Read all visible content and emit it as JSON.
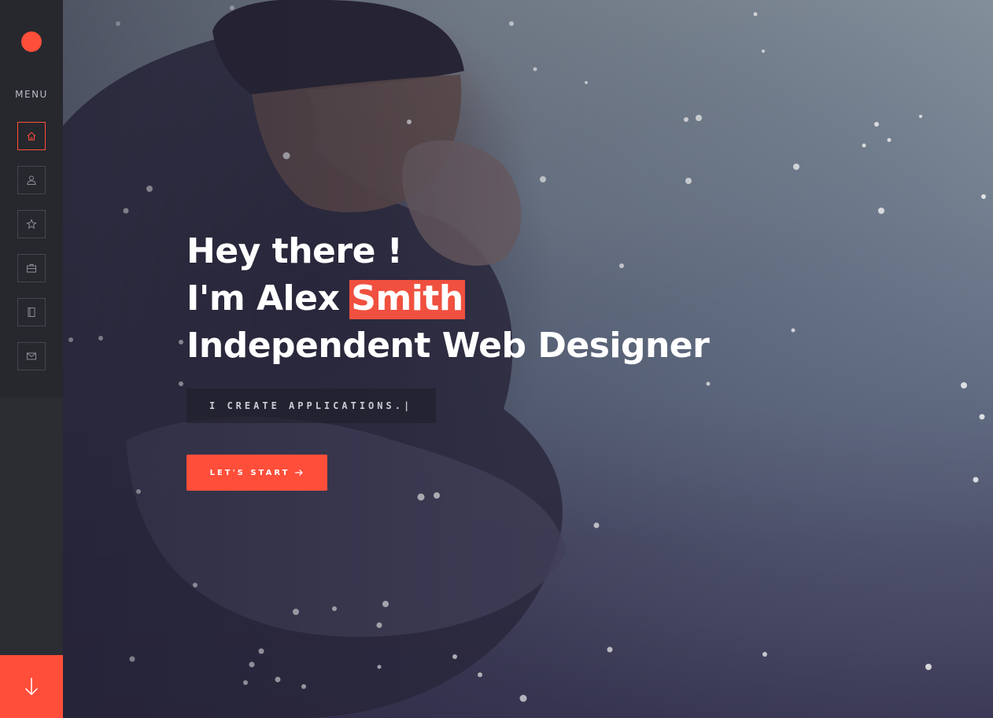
{
  "sidebar": {
    "menu_label": "MENU",
    "items": [
      {
        "name": "home",
        "icon": "home-icon",
        "active": true
      },
      {
        "name": "about",
        "icon": "user-icon",
        "active": false
      },
      {
        "name": "services",
        "icon": "star-icon",
        "active": false
      },
      {
        "name": "portfolio",
        "icon": "briefcase-icon",
        "active": false
      },
      {
        "name": "blog",
        "icon": "book-icon",
        "active": false
      },
      {
        "name": "contact",
        "icon": "mail-icon",
        "active": false
      }
    ],
    "scroll_icon": "arrow-down-icon"
  },
  "hero": {
    "line1": "Hey there !",
    "line2_prefix": "I'm Alex ",
    "line2_highlight": "Smith",
    "line3": "Independent Web Designer",
    "typed_text": "I CREATE APPLICATIONS.|",
    "cta_label": "LET'S START",
    "cta_icon": "arrow-right-icon"
  },
  "colors": {
    "accent": "#ff4e3a",
    "sidebar_bg": "#26282d",
    "text": "#ffffff"
  }
}
